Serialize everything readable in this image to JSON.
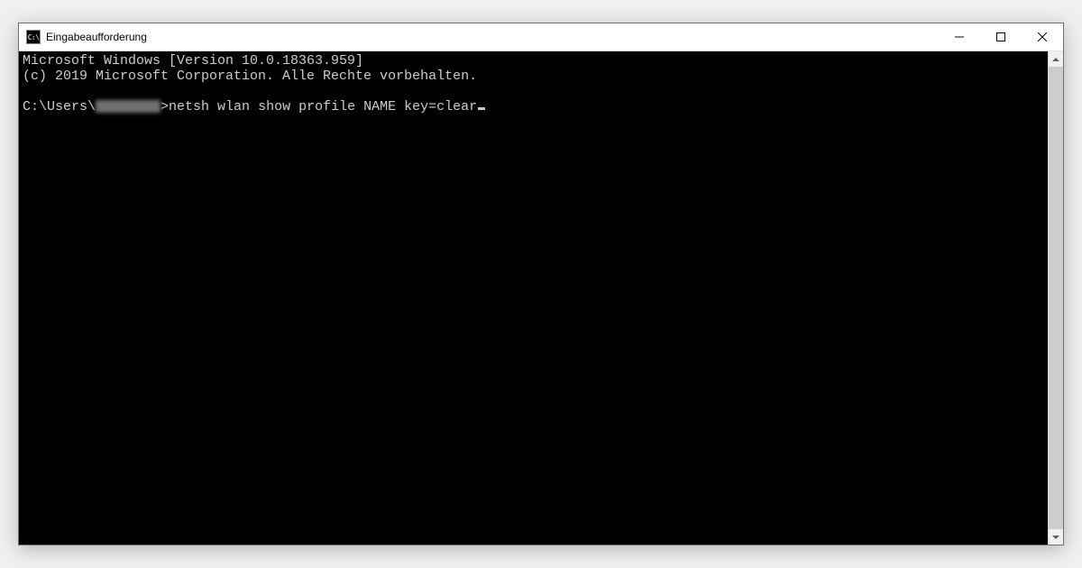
{
  "window": {
    "icon_text": "C:\\",
    "title": "Eingabeaufforderung"
  },
  "terminal": {
    "line1": "Microsoft Windows [Version 10.0.18363.959]",
    "line2": "(c) 2019 Microsoft Corporation. Alle Rechte vorbehalten.",
    "prompt_prefix": "C:\\Users\\",
    "blurred_user": "████████",
    "prompt_suffix": ">",
    "command": "netsh wlan show profile NAME key=clear"
  }
}
